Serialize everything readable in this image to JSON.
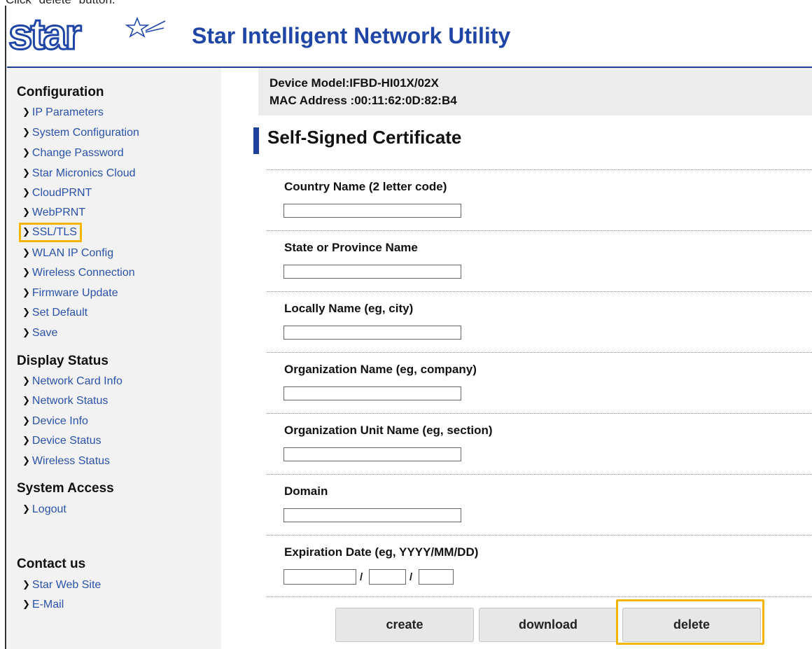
{
  "instruction": "Click \"delete\" button.",
  "header": {
    "logo_text": "star",
    "title": "Star Intelligent Network Utility"
  },
  "sidebar": {
    "configuration": {
      "heading": "Configuration",
      "items": [
        {
          "label": "IP Parameters"
        },
        {
          "label": "System Configuration"
        },
        {
          "label": "Change Password"
        },
        {
          "label": "Star Micronics Cloud"
        },
        {
          "label": "CloudPRNT"
        },
        {
          "label": "WebPRNT"
        },
        {
          "label": "SSL/TLS",
          "highlighted": true
        },
        {
          "label": "WLAN IP Config"
        },
        {
          "label": "Wireless Connection"
        },
        {
          "label": "Firmware Update"
        },
        {
          "label": "Set Default"
        },
        {
          "label": "Save"
        }
      ]
    },
    "display_status": {
      "heading": "Display Status",
      "items": [
        {
          "label": "Network Card Info"
        },
        {
          "label": "Network Status"
        },
        {
          "label": "Device Info"
        },
        {
          "label": "Device Status"
        },
        {
          "label": "Wireless Status"
        }
      ]
    },
    "system_access": {
      "heading": "System Access",
      "items": [
        {
          "label": "Logout"
        }
      ]
    },
    "contact": {
      "heading": "Contact us",
      "items": [
        {
          "label": "Star Web Site"
        },
        {
          "label": "E-Mail"
        }
      ]
    }
  },
  "device": {
    "model": "Device Model:IFBD-HI01X/02X",
    "mac": "MAC Address :00:11:62:0D:82:B4"
  },
  "page": {
    "title": "Self-Signed Certificate",
    "fields": [
      {
        "label": "Country Name (2 letter code)",
        "value": ""
      },
      {
        "label": "State or Province Name",
        "value": ""
      },
      {
        "label": "Locally Name (eg, city)",
        "value": ""
      },
      {
        "label": "Organization Name (eg, company)",
        "value": ""
      },
      {
        "label": "Organization Unit Name (eg, section)",
        "value": ""
      },
      {
        "label": "Domain",
        "value": ""
      }
    ],
    "expiration": {
      "label": "Expiration Date (eg, YYYY/MM/DD)",
      "separator": "/",
      "year": "",
      "month": "",
      "day": ""
    },
    "buttons": {
      "create": "create",
      "download": "download",
      "delete": "delete"
    }
  },
  "colors": {
    "brand_blue": "#1f46a6",
    "link_blue": "#2a52a8",
    "highlight": "#f5b400",
    "sidebar_bg": "#f2f2f2",
    "device_bar_bg": "#ececec"
  }
}
